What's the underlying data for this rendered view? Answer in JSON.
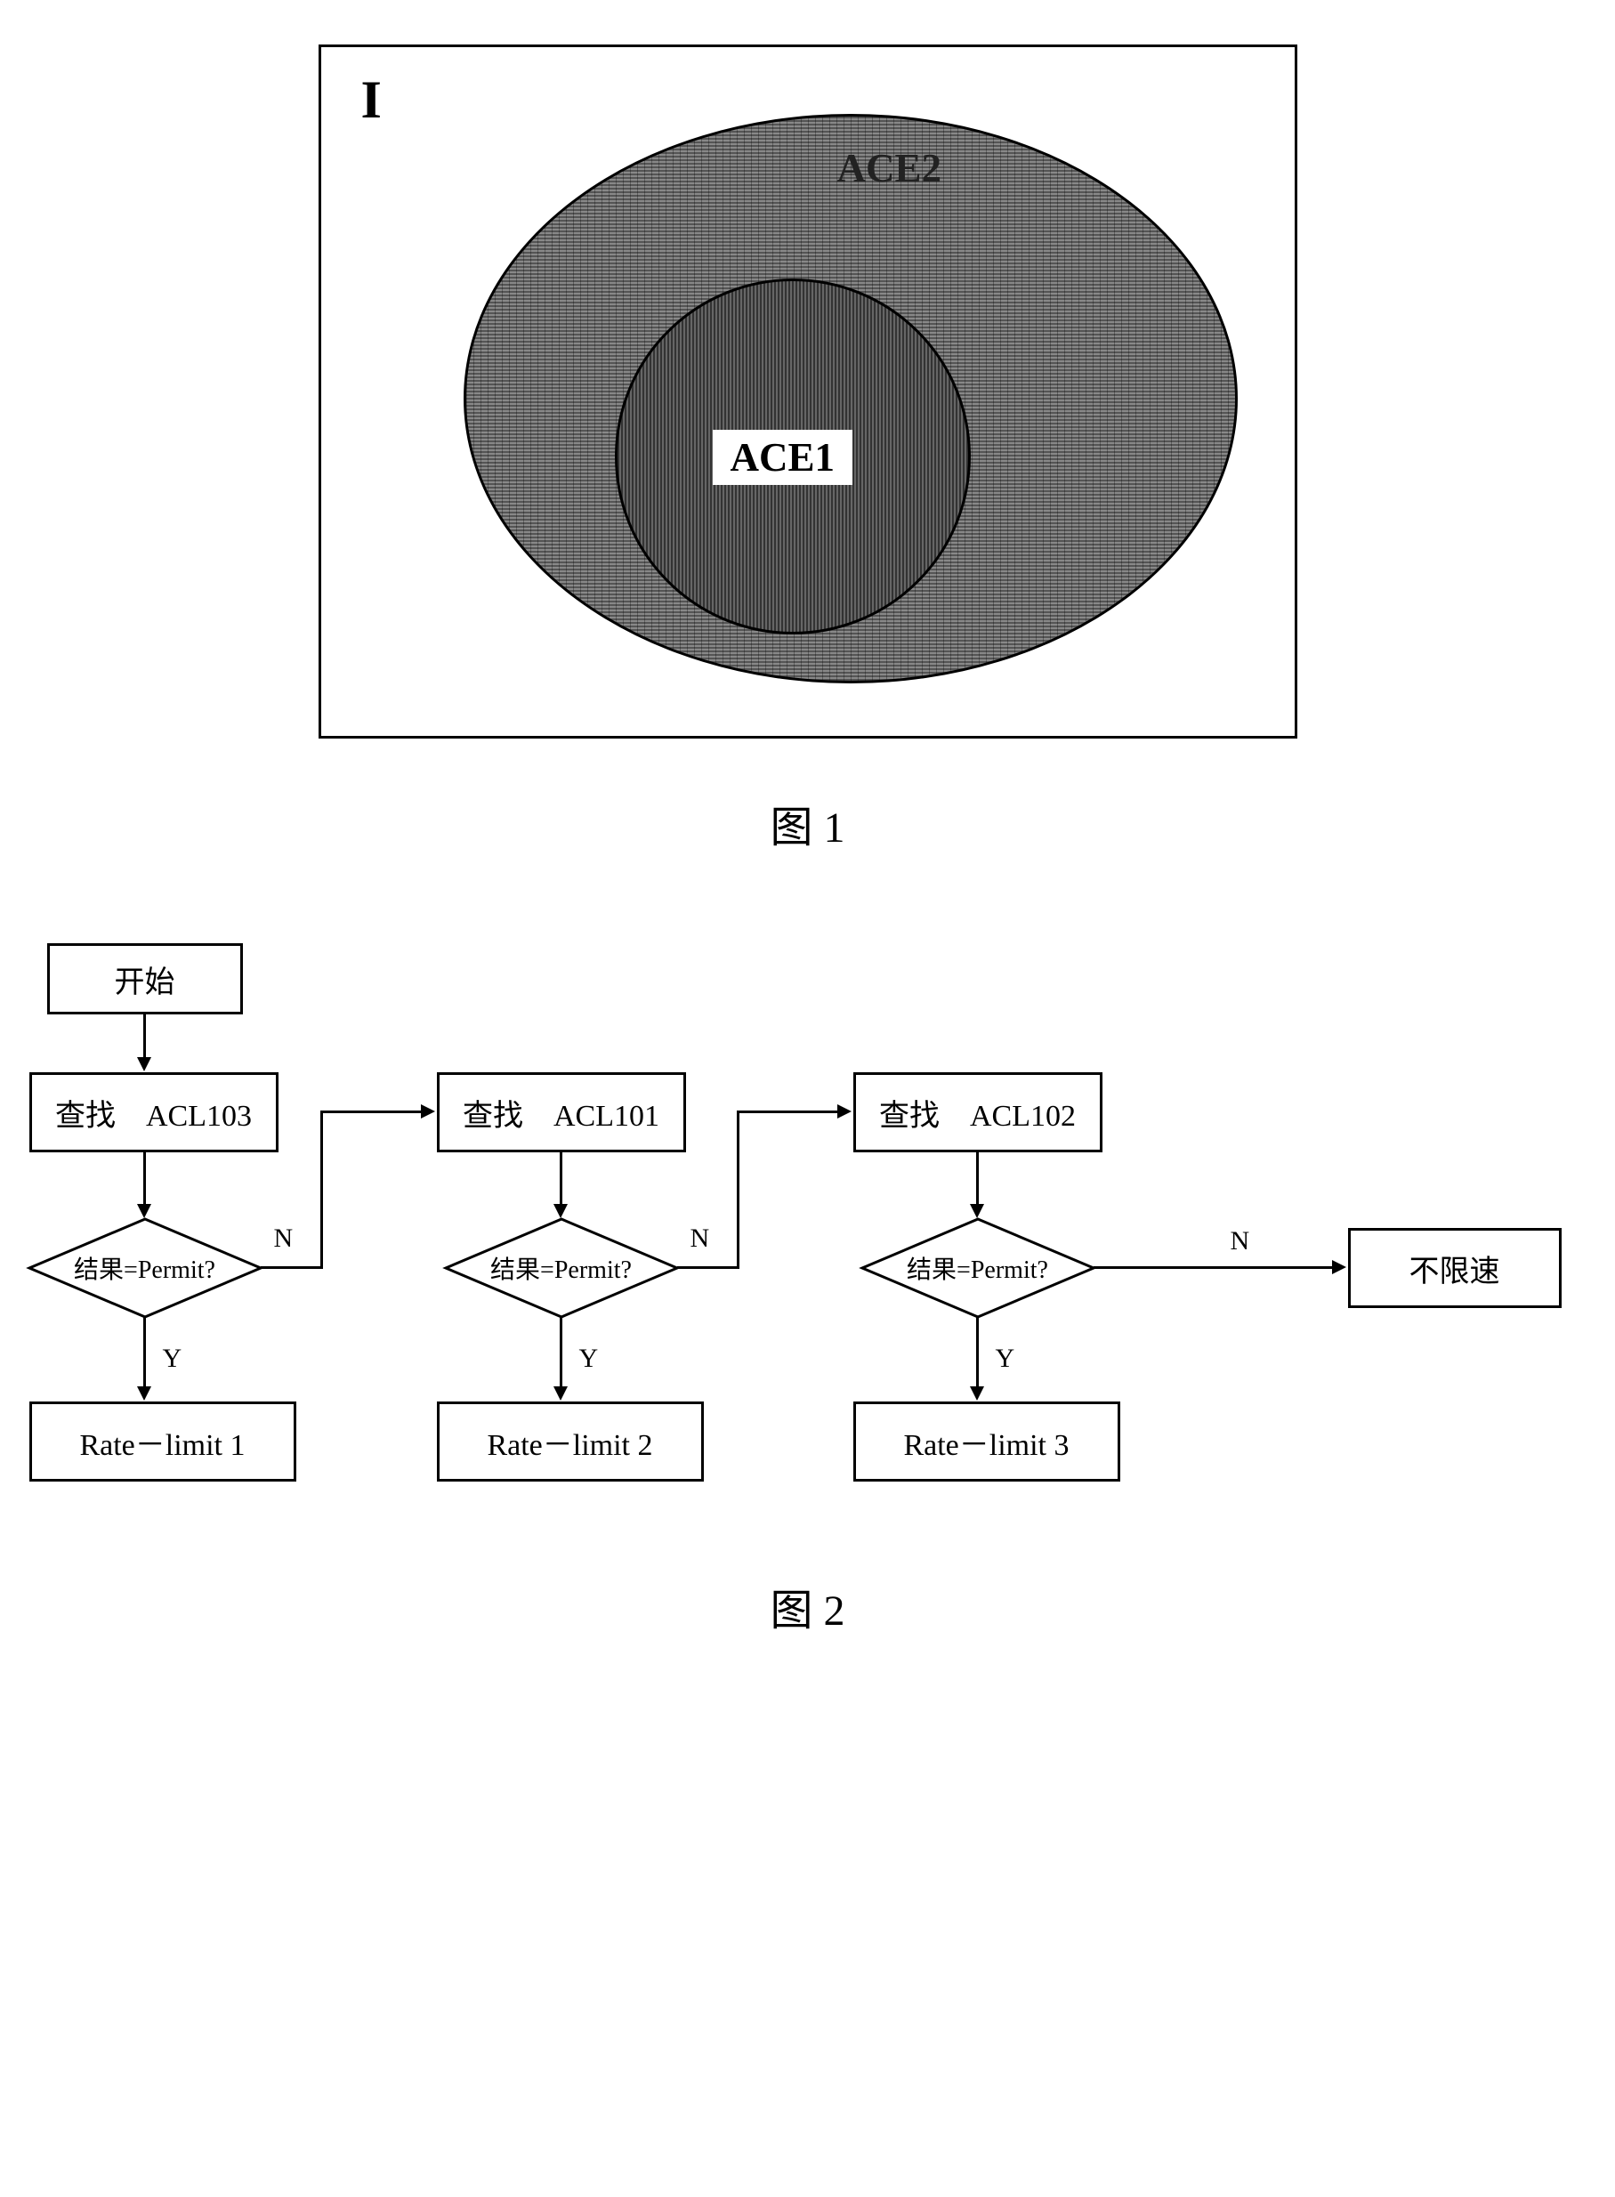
{
  "fig1": {
    "outerLabel": "I",
    "ace2": "ACE2",
    "ace1": "ACE1",
    "caption": "图 1"
  },
  "fig2": {
    "start": "开始",
    "lookup1": "查找　ACL103",
    "lookup2": "查找　ACL101",
    "lookup3": "查找　ACL102",
    "decision": "结果=Permit?",
    "yes": "Y",
    "no": "N",
    "rate1": "Rate－limit  1",
    "rate2": "Rate－limit  2",
    "rate3": "Rate－limit  3",
    "noLimit": "不限速",
    "caption": "图 2"
  },
  "chart_data": [
    {
      "type": "set-diagram",
      "title": "图 1",
      "universe": "I",
      "sets": [
        {
          "name": "ACE2",
          "contains": [
            "ACE1"
          ],
          "shape": "ellipse"
        },
        {
          "name": "ACE1",
          "contains": [],
          "shape": "circle"
        }
      ],
      "relation": "ACE1 ⊂ ACE2 ⊂ I"
    },
    {
      "type": "flowchart",
      "title": "图 2",
      "nodes": [
        {
          "id": "start",
          "kind": "terminator",
          "label": "开始"
        },
        {
          "id": "q1",
          "kind": "process",
          "label": "查找 ACL103"
        },
        {
          "id": "d1",
          "kind": "decision",
          "label": "结果=Permit?"
        },
        {
          "id": "r1",
          "kind": "process",
          "label": "Rate-limit 1"
        },
        {
          "id": "q2",
          "kind": "process",
          "label": "查找 ACL101"
        },
        {
          "id": "d2",
          "kind": "decision",
          "label": "结果=Permit?"
        },
        {
          "id": "r2",
          "kind": "process",
          "label": "Rate-limit 2"
        },
        {
          "id": "q3",
          "kind": "process",
          "label": "查找 ACL102"
        },
        {
          "id": "d3",
          "kind": "decision",
          "label": "结果=Permit?"
        },
        {
          "id": "r3",
          "kind": "process",
          "label": "Rate-limit 3"
        },
        {
          "id": "nolimit",
          "kind": "process",
          "label": "不限速"
        }
      ],
      "edges": [
        {
          "from": "start",
          "to": "q1"
        },
        {
          "from": "q1",
          "to": "d1"
        },
        {
          "from": "d1",
          "to": "r1",
          "label": "Y"
        },
        {
          "from": "d1",
          "to": "q2",
          "label": "N"
        },
        {
          "from": "q2",
          "to": "d2"
        },
        {
          "from": "d2",
          "to": "r2",
          "label": "Y"
        },
        {
          "from": "d2",
          "to": "q3",
          "label": "N"
        },
        {
          "from": "q3",
          "to": "d3"
        },
        {
          "from": "d3",
          "to": "r3",
          "label": "Y"
        },
        {
          "from": "d3",
          "to": "nolimit",
          "label": "N"
        }
      ]
    }
  ]
}
